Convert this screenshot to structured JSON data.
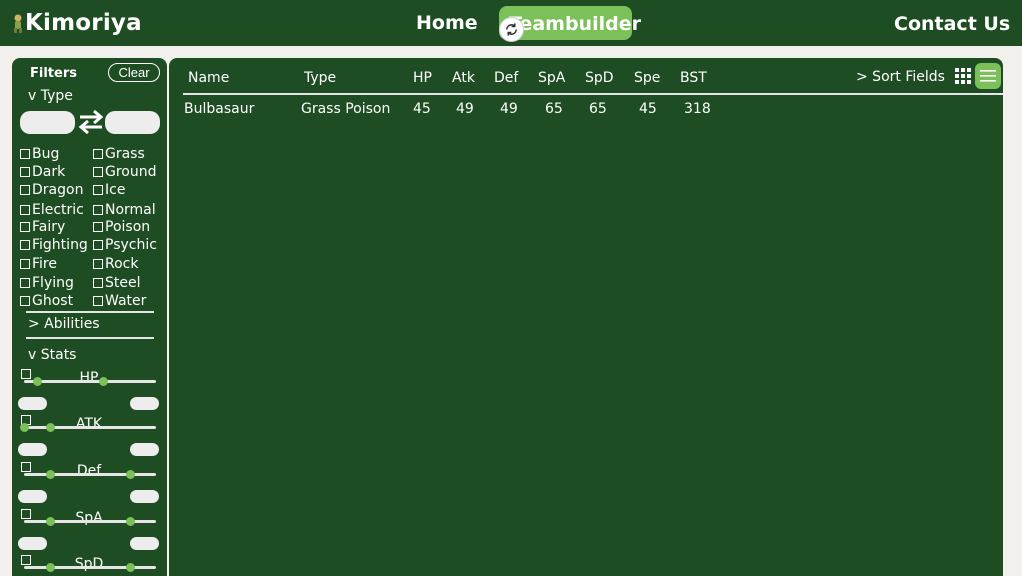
{
  "header": {
    "logo_text": "Kimoriya",
    "nav": {
      "home": "Home",
      "teambuilder": "Teambuilder",
      "contact": "Contact Us"
    }
  },
  "sidebar": {
    "title": "Filters",
    "clear_label": "Clear",
    "type_section": "v Type",
    "types_left": [
      "Bug",
      "Dark",
      "Dragon",
      "Electric",
      "Fairy",
      "Fighting",
      "Fire",
      "Flying",
      "Ghost"
    ],
    "types_right": [
      "Grass",
      "Ground",
      "Ice",
      "Normal",
      "Poison",
      "Psychic",
      "Rock",
      "Steel",
      "Water"
    ],
    "abilities_section": "> Abilities",
    "stats_section": "v Stats",
    "stats": [
      {
        "label": "HP",
        "range": [
          10,
          60
        ]
      },
      {
        "label": "ATK",
        "range": [
          0,
          20
        ]
      },
      {
        "label": "Def",
        "range": [
          20,
          80
        ]
      },
      {
        "label": "SpA",
        "range": [
          20,
          80
        ]
      },
      {
        "label": "SpD",
        "range": [
          20,
          80
        ]
      }
    ]
  },
  "table": {
    "columns": [
      "Name",
      "Type",
      "HP",
      "Atk",
      "Def",
      "SpA",
      "SpD",
      "Spe",
      "BST"
    ],
    "rows": [
      {
        "name": "Bulbasaur",
        "type": "Grass Poison",
        "hp": "45",
        "atk": "49",
        "def": "49",
        "spa": "65",
        "spd": "65",
        "spe": "45",
        "bst": "318"
      }
    ],
    "sort_fields_label": "> Sort Fields"
  },
  "icons": {
    "logo": "pokemon-sprite-icon",
    "refresh": "refresh-icon",
    "swap": "swap-arrows-icon",
    "grid_view": "grid-view-icon",
    "list_view": "list-view-icon"
  },
  "colors": {
    "panel": "#1f4d23",
    "accent": "#7cc05a",
    "background": "#f2f0ec"
  }
}
